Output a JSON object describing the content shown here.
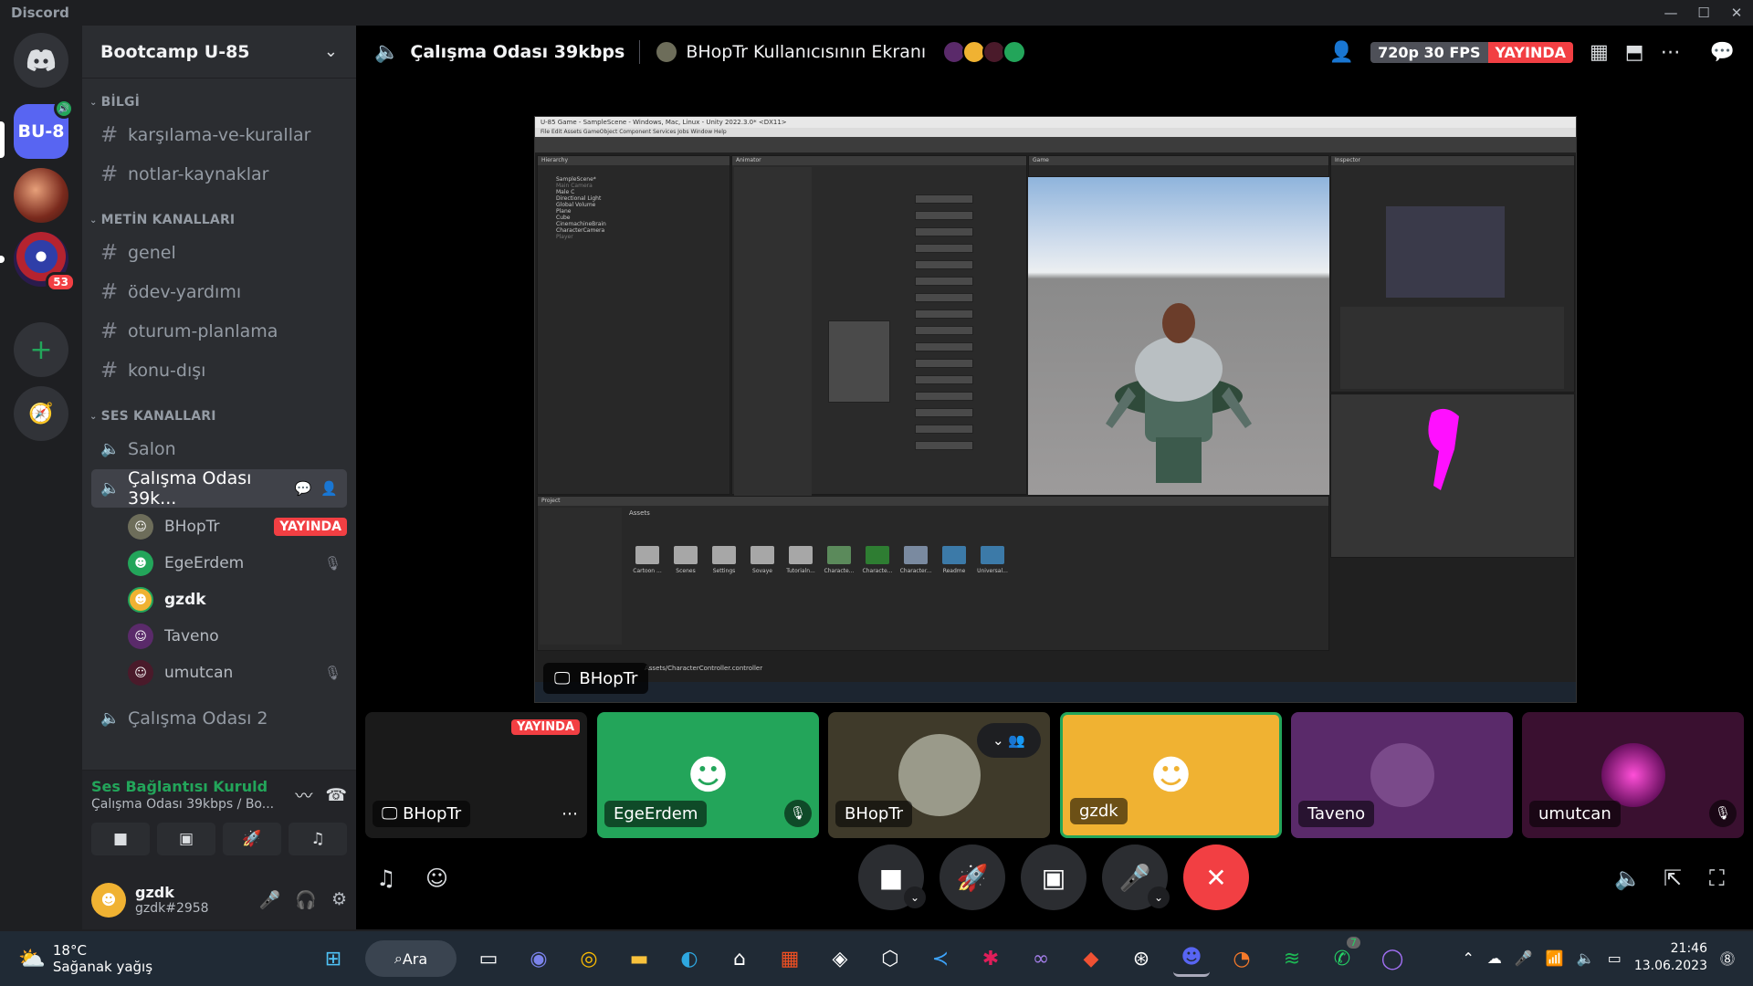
{
  "app": {
    "title": "Discord"
  },
  "window_controls": [
    "—",
    "☐",
    "✕"
  ],
  "servers": [
    {
      "name": "home",
      "icon": "discord-icon"
    },
    {
      "name": "BU-8",
      "label": "BU-8"
    },
    {
      "name": "server-2"
    },
    {
      "name": "server-3",
      "badge": "53"
    }
  ],
  "guild": {
    "name": "Bootcamp U-85"
  },
  "categories": {
    "info": "BİLGİ",
    "text": "METİN KANALLARI",
    "voice": "SES KANALLARI"
  },
  "info_channels": [
    "karşılama-ve-kurallar",
    "notlar-kaynaklar"
  ],
  "text_channels": [
    "genel",
    "ödev-yardımı",
    "oturum-planlama",
    "konu-dışı"
  ],
  "voice_channels": {
    "salon": "Salon",
    "active": "Çalışma Odası 39k...",
    "other": "Çalışma Odası 2"
  },
  "voice_users": [
    {
      "name": "BHopTr",
      "live": "YAYINDA",
      "color": "#6d6d5a"
    },
    {
      "name": "EgeErdem",
      "color": "#23a55a",
      "muted": true
    },
    {
      "name": "gzdk",
      "color": "#f0b232"
    },
    {
      "name": "Taveno",
      "color": "#5a2a6a"
    },
    {
      "name": "umutcan",
      "color": "#4a1a2a",
      "muted": true
    }
  ],
  "voice_panel": {
    "status": "Ses Bağlantısı Kuruld",
    "sub": "Çalışma Odası 39kbps / Bo..."
  },
  "user": {
    "name": "gzdk",
    "tag": "gzdk#2958"
  },
  "stage": {
    "channel": "Çalışma Odası 39kbps",
    "screen_title": "BHopTr Kullanıcısının Ekranı",
    "fps": "720p 30 FPS",
    "live": "YAYINDA",
    "stream_label": "BHopTr"
  },
  "unity": {
    "window_title": "U-85 Game - SampleScene - Windows, Mac, Linux - Unity 2022.3.0* <DX11>",
    "menu": "File   Edit   Assets   GameObject   Component   Services   Jobs   Window   Help",
    "hierarchy_title": "Hierarchy",
    "hierarchy": [
      "SampleScene*",
      "Main Camera",
      "Male C",
      "Directional Light",
      "Global Volume",
      "Plane",
      "Cube",
      "CinemachineBrain",
      "CharacterCamera",
      "Player"
    ],
    "animator_title": "Animator",
    "game_title": "Game",
    "inspector_title": "Inspector",
    "project_title": "Project",
    "assets_label": "Assets",
    "folders": [
      "Cartoon ...",
      "Scenes",
      "Settings",
      "Sovaye",
      "Tutorialn...",
      "Characte...",
      "Characte...",
      "Character...",
      "Readme",
      "Universal..."
    ],
    "status_path": "Assets/CharacterController.controller"
  },
  "tiles": [
    {
      "name": "BHopTr",
      "live": "YAYINDA",
      "bg": "#1a1a1a"
    },
    {
      "name": "EgeErdem",
      "bg": "#23a55a",
      "muted": true
    },
    {
      "name": "BHopTr",
      "bg": "#3f3a2a"
    },
    {
      "name": "gzdk",
      "bg": "#f0b232"
    },
    {
      "name": "Taveno",
      "bg": "#5a2a6a"
    },
    {
      "name": "umutcan",
      "bg": "#3a1030",
      "muted": true
    }
  ],
  "taskbar": {
    "temp": "18°C",
    "weather": "Sağanak yağış",
    "search": "Ara",
    "time": "21:46",
    "date": "13.06.2023",
    "badge": "7"
  }
}
